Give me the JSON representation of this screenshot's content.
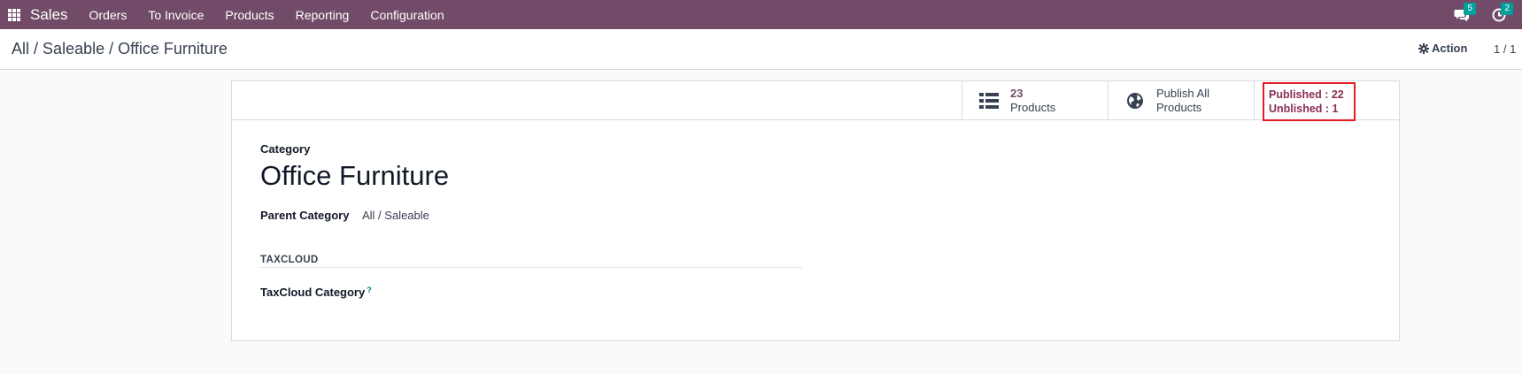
{
  "navbar": {
    "app_name": "Sales",
    "menu": [
      "Orders",
      "To Invoice",
      "Products",
      "Reporting",
      "Configuration"
    ],
    "messages_badge": "5",
    "activities_badge": "2",
    "color": "#714b67"
  },
  "control_panel": {
    "breadcrumb": [
      "All",
      "Saleable",
      "Office Furniture"
    ],
    "breadcrumb_sep": "/",
    "action_label": "Action",
    "pager": "1 / 1"
  },
  "stat_buttons": {
    "products_count": "23",
    "products_label": "Products",
    "publish_line1": "Publish All",
    "publish_line2": "Products",
    "published_label": "Published : 22",
    "unpublished_label": "Unblished : 1"
  },
  "form": {
    "category_label": "Category",
    "category_name": "Office Furniture",
    "parent_label": "Parent Category",
    "parent_value": "All / Saleable",
    "section_title": "TAXCLOUD",
    "taxcloud_label": "TaxCloud Category",
    "help_mark": "?"
  }
}
